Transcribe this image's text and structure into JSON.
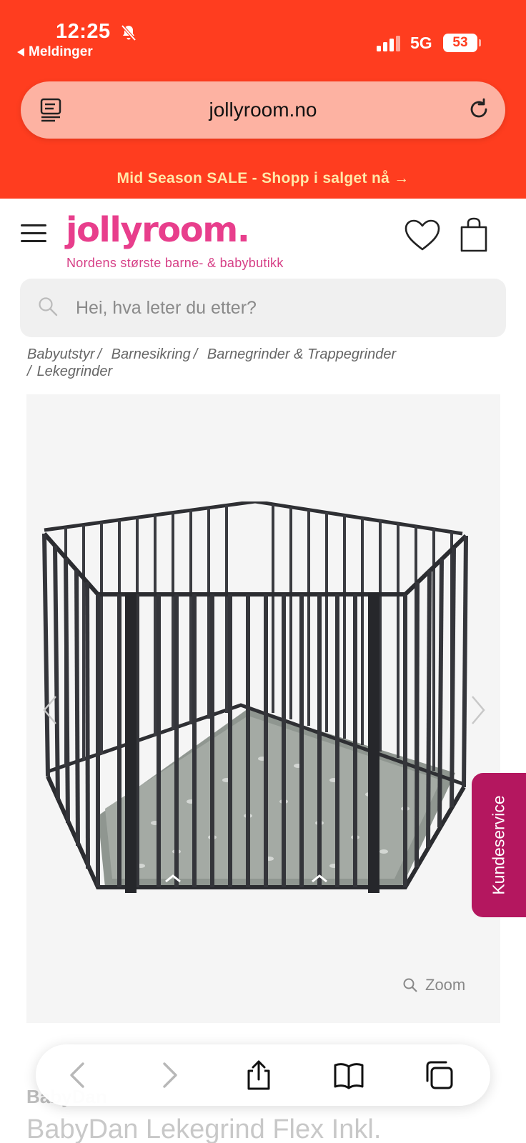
{
  "status_bar": {
    "time": "12:25",
    "back_app": "Meldinger",
    "network": "5G",
    "battery": "53"
  },
  "browser": {
    "url": "jollyroom.no"
  },
  "promo": {
    "text": "Mid Season SALE - Shopp i salget nå →"
  },
  "header": {
    "logo": "jollyroom.",
    "tagline": "Nordens største barne- & babybutikk"
  },
  "search": {
    "placeholder": "Hei, hva leter du etter?"
  },
  "breadcrumb": [
    "Babyutstyr",
    "Barnesikring",
    "Barnegrinder & Trappegrinder",
    "Lekegrinder"
  ],
  "product": {
    "zoom_label": "Zoom",
    "brand": "BabyDan",
    "title": "BabyDan Lekegrind Flex Inkl."
  },
  "kundeservice": {
    "label": "Kundeservice"
  },
  "colors": {
    "brand_pink": "#e83e8c",
    "top_bar": "#ff3d1f",
    "kundeservice": "#b4175f"
  }
}
